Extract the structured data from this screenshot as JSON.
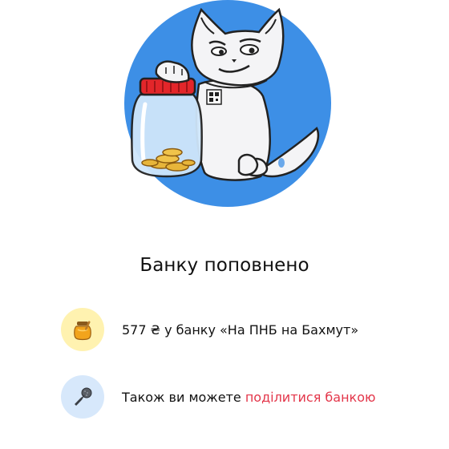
{
  "hero": {
    "illustration": "cat-holding-money-jar",
    "circle_color": "#3d8fe6"
  },
  "title": "Банку поповнено",
  "summary": {
    "icon": "honey-jar-icon",
    "amount": "577 ₴",
    "middle": " у банку ",
    "jar_name": "«На ПНБ на Бахмут»"
  },
  "share": {
    "icon": "microphone-icon",
    "text": "Також ви можете ",
    "link": "поділитися банкою",
    "link_color": "#e3364a"
  }
}
